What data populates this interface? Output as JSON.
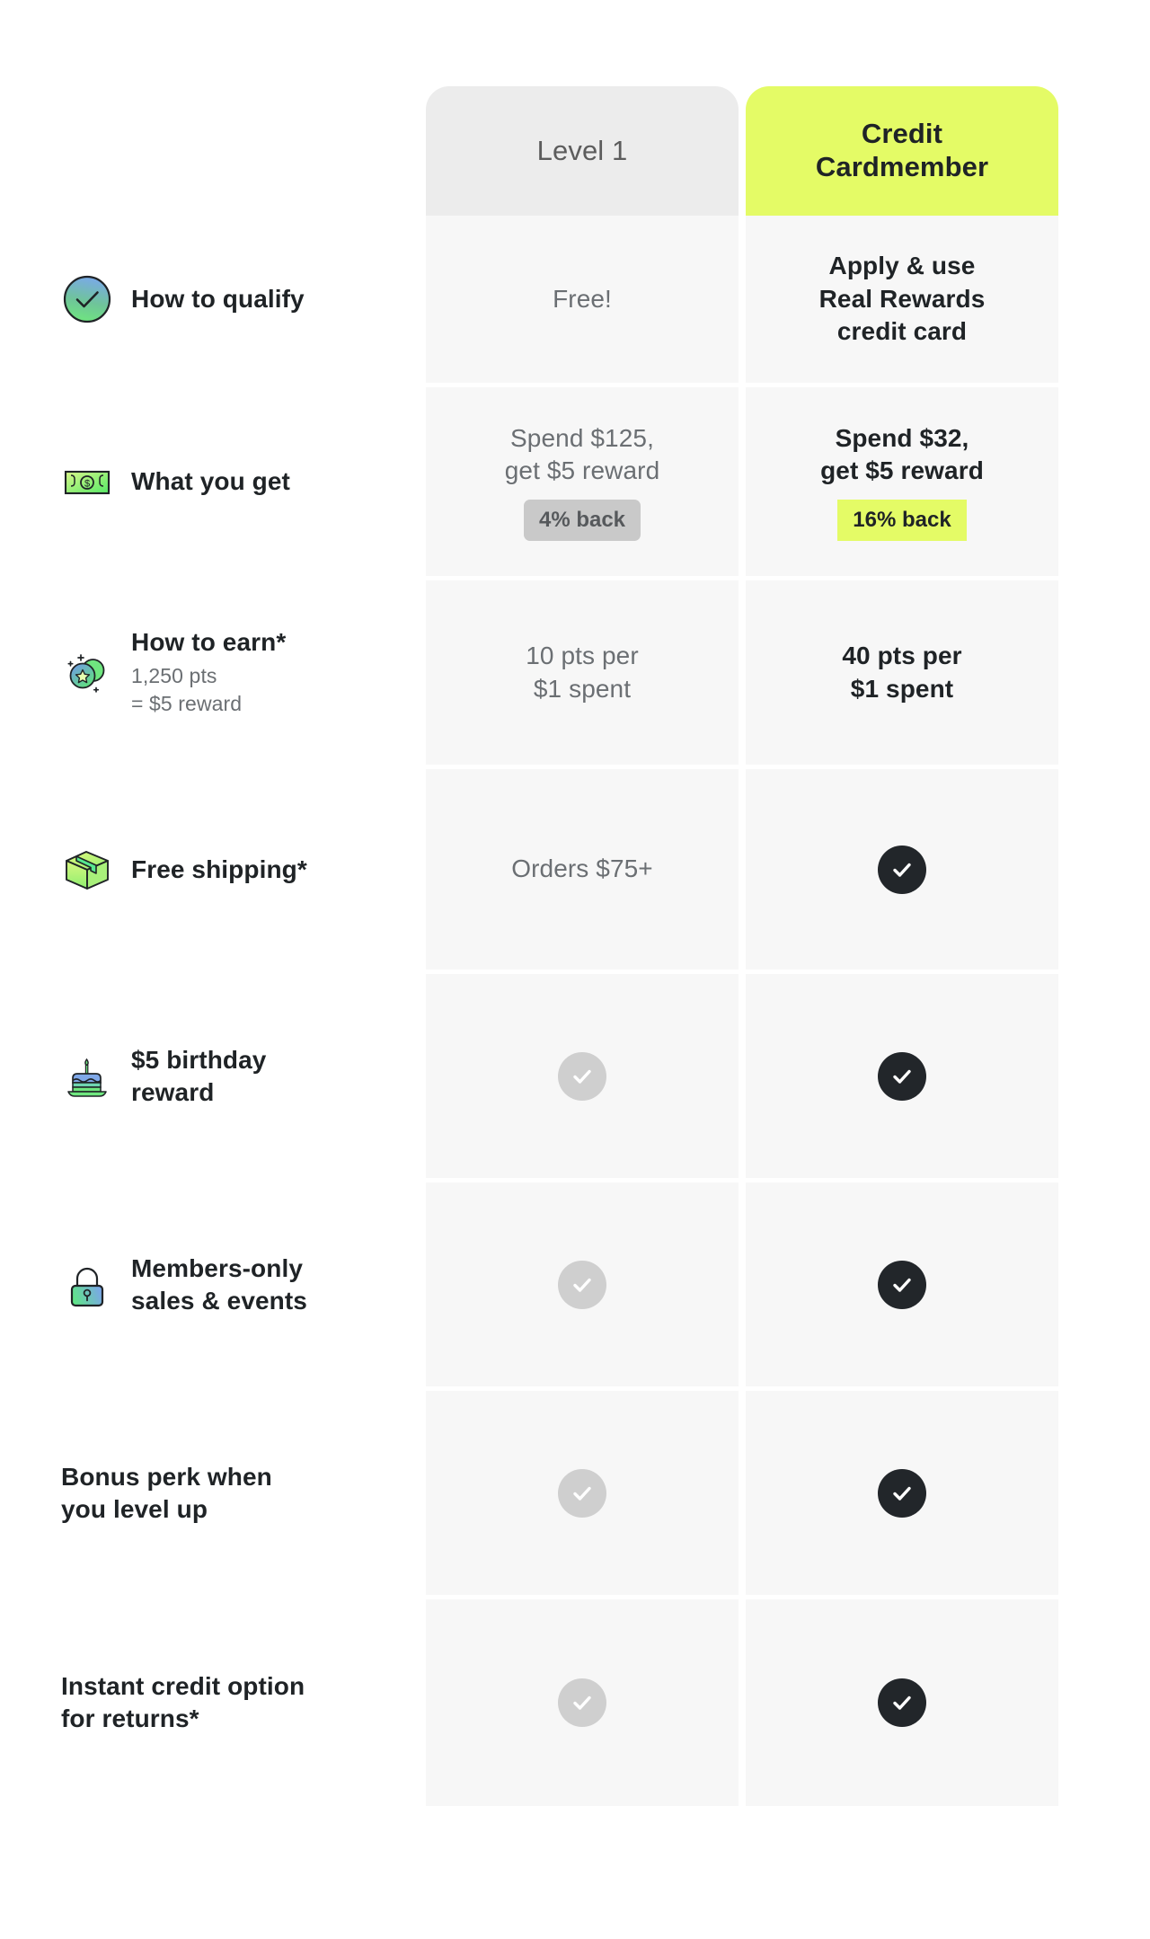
{
  "columns": [
    {
      "id": "level1",
      "label": "Level 1",
      "style": "gray"
    },
    {
      "id": "credit",
      "label": "Credit\nCardmember",
      "label_line1": "Credit",
      "label_line2": "Cardmember",
      "style": "lime",
      "accent": "#e4fb66"
    }
  ],
  "colors": {
    "lime": "#e4fb66",
    "tab_gray": "#ececec",
    "cell_bg": "#f7f7f7",
    "text_dark": "#1f2326",
    "text_muted": "#6b6f73",
    "check_gray": "#cfcfcf",
    "check_dark": "#22262a",
    "badge_gray": "#c9c9c9"
  },
  "rows": [
    {
      "icon": "check-circle-gradient-icon",
      "title": "How to qualify",
      "sub": "",
      "left": {
        "type": "text",
        "lines": [
          "Free!"
        ]
      },
      "right": {
        "type": "text",
        "lines": [
          "Apply & use",
          "Real Rewards",
          "credit card"
        ]
      }
    },
    {
      "icon": "money-bill-icon",
      "title": "What you get",
      "sub": "",
      "left": {
        "type": "text",
        "lines": [
          "Spend $125,",
          "get $5 reward"
        ],
        "badge": "4% back"
      },
      "right": {
        "type": "text",
        "lines": [
          "Spend $32,",
          "get $5 reward"
        ],
        "badge": "16% back"
      }
    },
    {
      "icon": "points-star-icon",
      "title": "How to earn*",
      "sub": "1,250 pts\n= $5 reward",
      "sub_line1": "1,250 pts",
      "sub_line2": "= $5 reward",
      "left": {
        "type": "text",
        "lines": [
          "10 pts per",
          "$1 spent"
        ]
      },
      "right": {
        "type": "text",
        "lines": [
          "40 pts per",
          "$1 spent"
        ]
      }
    },
    {
      "icon": "package-box-icon",
      "title": "Free shipping*",
      "sub": "",
      "left": {
        "type": "text",
        "lines": [
          "Orders $75+"
        ]
      },
      "right": {
        "type": "check",
        "state": "dark"
      }
    },
    {
      "icon": "birthday-cake-icon",
      "title": "$5 birthday\nreward",
      "title_line1": "$5 birthday",
      "title_line2": "reward",
      "sub": "",
      "left": {
        "type": "check",
        "state": "gray"
      },
      "right": {
        "type": "check",
        "state": "dark"
      }
    },
    {
      "icon": "lock-icon",
      "title": "Members-only\nsales & events",
      "title_line1": "Members-only",
      "title_line2": "sales & events",
      "sub": "",
      "left": {
        "type": "check",
        "state": "gray"
      },
      "right": {
        "type": "check",
        "state": "dark"
      }
    },
    {
      "icon": "",
      "title": "Bonus perk when\nyou level up",
      "title_line1": "Bonus perk when",
      "title_line2": "you level up",
      "sub": "",
      "left": {
        "type": "check",
        "state": "gray"
      },
      "right": {
        "type": "check",
        "state": "dark"
      }
    },
    {
      "icon": "",
      "title": "Instant credit option\nfor returns*",
      "title_line1": "Instant credit option",
      "title_line2": "for returns*",
      "sub": "",
      "left": {
        "type": "check",
        "state": "gray"
      },
      "right": {
        "type": "check",
        "state": "dark"
      }
    }
  ]
}
